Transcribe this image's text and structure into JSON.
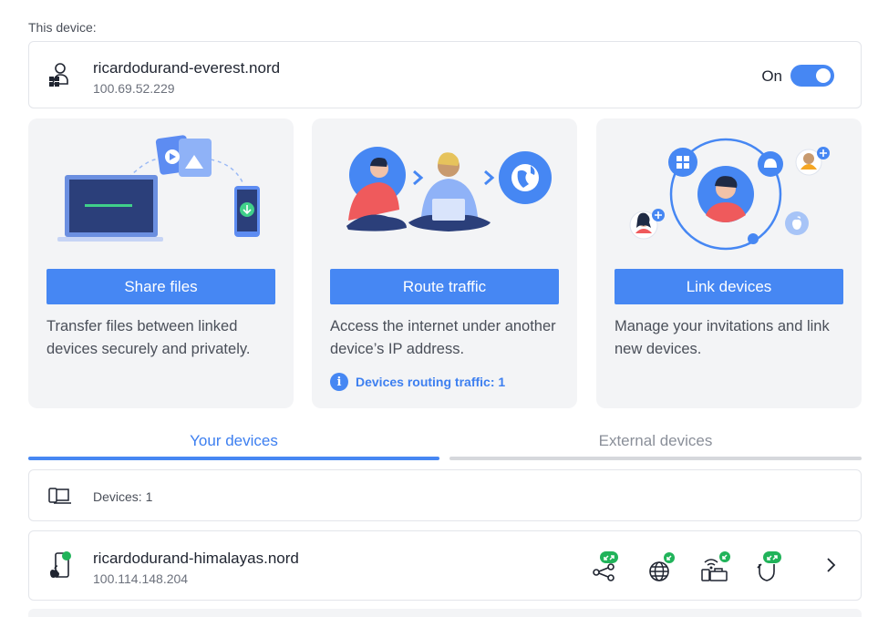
{
  "this_device": {
    "section_label": "This device:",
    "name": "ricardodurand-everest.nord",
    "ip": "100.69.52.229",
    "toggle_label": "On",
    "toggle_state": "on"
  },
  "cards": [
    {
      "button": "Share files",
      "description": "Transfer files between linked devices securely and privately."
    },
    {
      "button": "Route traffic",
      "description": "Access the internet under another device’s IP address.",
      "status": "Devices routing traffic: 1"
    },
    {
      "button": "Link devices",
      "description": "Manage your invitations and link new devices."
    }
  ],
  "tabs": [
    {
      "label": "Your devices",
      "active": true
    },
    {
      "label": "External devices",
      "active": false
    }
  ],
  "devices_count_label": "Devices: 1",
  "devices": [
    {
      "name": "ricardodurand-himalayas.nord",
      "ip": "100.114.148.204",
      "permission_icons": [
        "file-share-permission-icon",
        "route-traffic-permission-icon",
        "local-network-permission-icon",
        "send-files-permission-icon"
      ]
    }
  ],
  "colors": {
    "accent": "#4687f3",
    "card_bg": "#f3f4f6",
    "badge_green": "#21b35a",
    "illustration_red": "#ef5a5c"
  }
}
